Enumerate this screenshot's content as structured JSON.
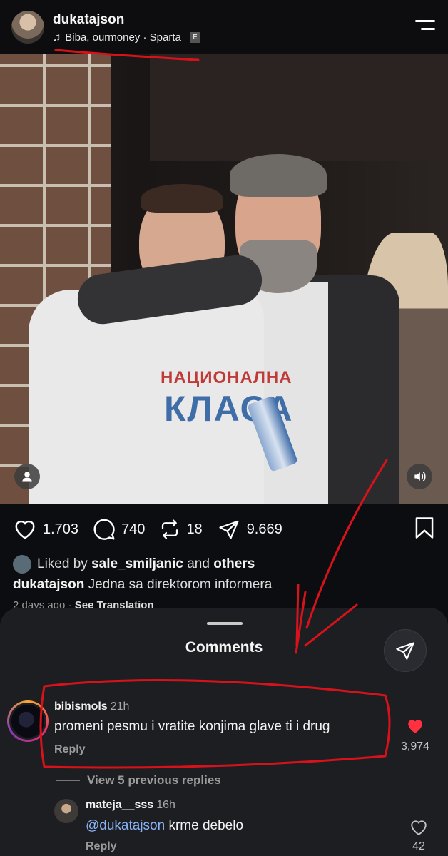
{
  "header": {
    "username": "dukatajson",
    "music_icon": "music-note-icon",
    "music_text": "Biba, ourmoney · Sparta",
    "explicit_label": "E"
  },
  "photo": {
    "shirt_line1": "НАЦИОНАЛНА",
    "shirt_line2": "КЛАСА"
  },
  "actions": {
    "likes": "1.703",
    "comments": "740",
    "reposts": "18",
    "shares": "9.669"
  },
  "post": {
    "liked_by_prefix": "Liked by",
    "liked_by_user": "sale_smiljanic",
    "liked_by_and": "and",
    "liked_by_others": "others",
    "author": "dukatajson",
    "caption": "Jedna sa direktorom informera",
    "time": "2 days ago",
    "see_translation": "See Translation"
  },
  "sheet": {
    "title": "Comments",
    "comments": [
      {
        "user": "bibismols",
        "time": "21h",
        "text": "promeni pesmu i vratite konjima glave ti i drug",
        "reply": "Reply",
        "likes": "3,974",
        "liked": true
      },
      {
        "user": "mateja__sss",
        "time": "16h",
        "mention": "@dukatajson",
        "text": "krme debelo",
        "reply": "Reply",
        "likes": "42",
        "liked": false
      }
    ],
    "view_replies": "View 5 previous replies"
  },
  "colors": {
    "annotation_red": "#d8121a",
    "like_red": "#ff3040",
    "mention_blue": "#8ab4f8"
  }
}
